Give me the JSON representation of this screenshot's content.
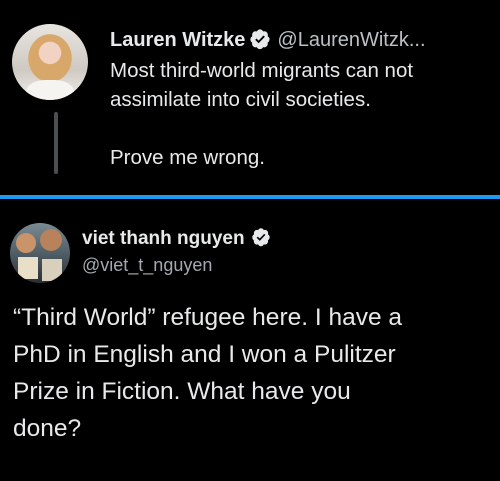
{
  "tweet_top": {
    "display_name": "Lauren Witzke",
    "handle": "@LaurenWitzk...",
    "text_lines": [
      "Most third-world migrants can not",
      "assimilate into civil societies."
    ],
    "text_line_final": "Prove me wrong.",
    "verified_icon": "verified-badge-icon"
  },
  "tweet_bottom": {
    "display_name": "viet thanh nguyen",
    "handle": "@viet_t_nguyen",
    "verified_icon": "verified-badge-icon",
    "text_lines": [
      "“Third World” refugee here. I have a",
      "PhD in English and I won a Pulitzer",
      "Prize in Fiction. What have you",
      "done?"
    ]
  },
  "colors": {
    "background": "#000000",
    "divider": "#1d9bf0",
    "text": "#e7e9ea",
    "handle": "#bcc1c6"
  }
}
